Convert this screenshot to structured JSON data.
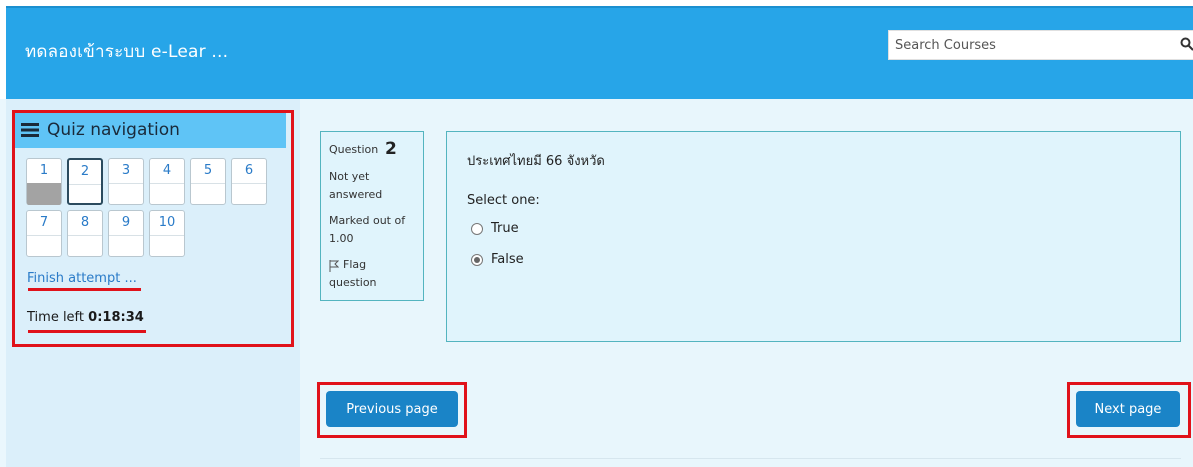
{
  "header": {
    "site_title": "ทดลองเข้าระบบ e-Lear ...",
    "search_placeholder": "Search Courses",
    "search_icon": "search-icon"
  },
  "quiz_nav": {
    "title": "Quiz navigation",
    "questions": [
      {
        "label": "1",
        "state": "answered"
      },
      {
        "label": "2",
        "state": "current"
      },
      {
        "label": "3",
        "state": "unanswered"
      },
      {
        "label": "4",
        "state": "unanswered"
      },
      {
        "label": "5",
        "state": "unanswered"
      },
      {
        "label": "6",
        "state": "unanswered"
      },
      {
        "label": "7",
        "state": "unanswered"
      },
      {
        "label": "8",
        "state": "unanswered"
      },
      {
        "label": "9",
        "state": "unanswered"
      },
      {
        "label": "10",
        "state": "unanswered"
      }
    ],
    "finish_label": "Finish attempt ...",
    "time_left_label": "Time left",
    "time_left_value": "0:18:34"
  },
  "question_info": {
    "question_label": "Question",
    "question_number": "2",
    "status_line1": "Not yet",
    "status_line2": "answered",
    "marked_line1": "Marked out of",
    "marked_line2": "1.00",
    "flag_line1": "Flag",
    "flag_line2": "question"
  },
  "question": {
    "text": "ประเทศไทยมี 66 จังหวัด",
    "prompt": "Select one:",
    "options": [
      {
        "label": "True",
        "selected": false
      },
      {
        "label": "False",
        "selected": true
      }
    ]
  },
  "buttons": {
    "previous": "Previous page",
    "next": "Next page"
  },
  "colors": {
    "header_bg": "#27a5e8",
    "nav_header_bg": "#5fc4f6",
    "button_bg": "#1a84c7",
    "annotation_red": "#e0121a",
    "link_blue": "#2a7bc8"
  }
}
